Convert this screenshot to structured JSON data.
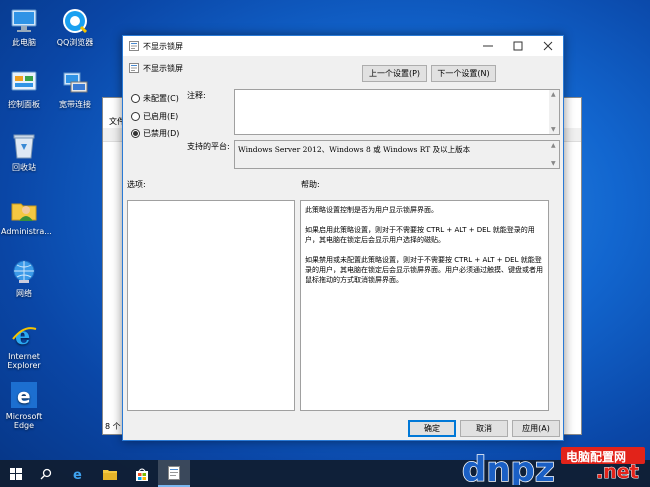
{
  "desktop": {
    "icons": [
      {
        "label": "此电脑"
      },
      {
        "label": "QQ浏览器"
      },
      {
        "label": "控制面板"
      },
      {
        "label": "宽带连接"
      },
      {
        "label": "回收站"
      },
      {
        "label": "Administra..."
      },
      {
        "label": "网络"
      },
      {
        "label": "Internet Explorer"
      },
      {
        "label": "Microsoft Edge"
      }
    ]
  },
  "background_window": {
    "menu_text": "文件",
    "status_text": "8 个"
  },
  "dialog": {
    "title": "不显示锁屏",
    "header_title": "不显示锁屏",
    "prev_button": "上一个设置(P)",
    "next_button": "下一个设置(N)",
    "radio_not_configured": "未配置(C)",
    "radio_enabled": "已启用(E)",
    "radio_disabled": "已禁用(D)",
    "selected_option": "disabled",
    "comment_label": "注释:",
    "comment_value": "",
    "platform_label": "支持的平台:",
    "platform_value": "Windows Server 2012、Windows 8 或 Windows RT 及以上版本",
    "options_label": "选项:",
    "help_label": "帮助:",
    "help_paragraphs": [
      "此策略设置控制是否为用户显示锁屏界面。",
      "如果启用此策略设置，则对于不需要按 CTRL + ALT + DEL 就能登录的用户，其电脑在锁定后会显示用户选择的磁贴。",
      "如果禁用或未配置此策略设置，则对于不需要按 CTRL + ALT + DEL 就能登录的用户，其电脑在锁定后会显示锁屏界面。用户必须通过触摸、键盘或者用鼠标拖动的方式取消锁屏界面。"
    ],
    "ok_button": "确定",
    "cancel_button": "取消",
    "apply_button": "应用(A)"
  },
  "watermark": {
    "brand": "dnpz",
    "suffix": ".net",
    "tagline": "电脑配置网"
  },
  "colors": {
    "accent": "#0078d7",
    "desktop": "#1266cf",
    "taskbar": "#101e32",
    "watermark_red": "#e2231a",
    "watermark_blue": "#1a5fc4"
  }
}
